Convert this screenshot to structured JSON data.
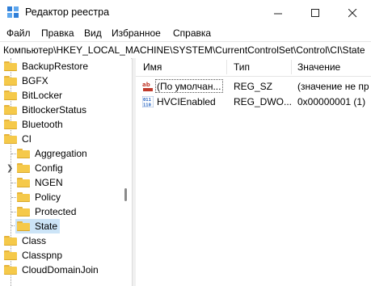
{
  "window": {
    "title": "Редактор реестра"
  },
  "menu": [
    "Файл",
    "Правка",
    "Вид",
    "Избранное",
    "Справка"
  ],
  "address": "Компьютер\\HKEY_LOCAL_MACHINE\\SYSTEM\\CurrentControlSet\\Control\\CI\\State",
  "tree": {
    "items": [
      {
        "label": "BackupRestore"
      },
      {
        "label": "BGFX"
      },
      {
        "label": "BitLocker"
      },
      {
        "label": "BitlockerStatus"
      },
      {
        "label": "Bluetooth"
      },
      {
        "label": "CI"
      },
      {
        "label": "Aggregation"
      },
      {
        "label": "Config"
      },
      {
        "label": "NGEN"
      },
      {
        "label": "Policy"
      },
      {
        "label": "Protected"
      },
      {
        "label": "State",
        "selected": true
      },
      {
        "label": "Class"
      },
      {
        "label": "Classpnp"
      },
      {
        "label": "CloudDomainJoin"
      }
    ]
  },
  "list": {
    "columns": [
      "Имя",
      "Тип",
      "Значение"
    ],
    "rows": [
      {
        "name": "(По умолчан...",
        "type": "REG_SZ",
        "value": "(значение не пр",
        "icon": "string-value-icon"
      },
      {
        "name": "HVCIEnabled",
        "type": "REG_DWO...",
        "value": "0x00000001 (1)",
        "icon": "binary-value-icon"
      }
    ]
  },
  "colors": {
    "selection": "#cce4f7",
    "folder": "#f5c94a",
    "string_icon": "#c0392b",
    "binary_icon": "#1f5fbf"
  }
}
